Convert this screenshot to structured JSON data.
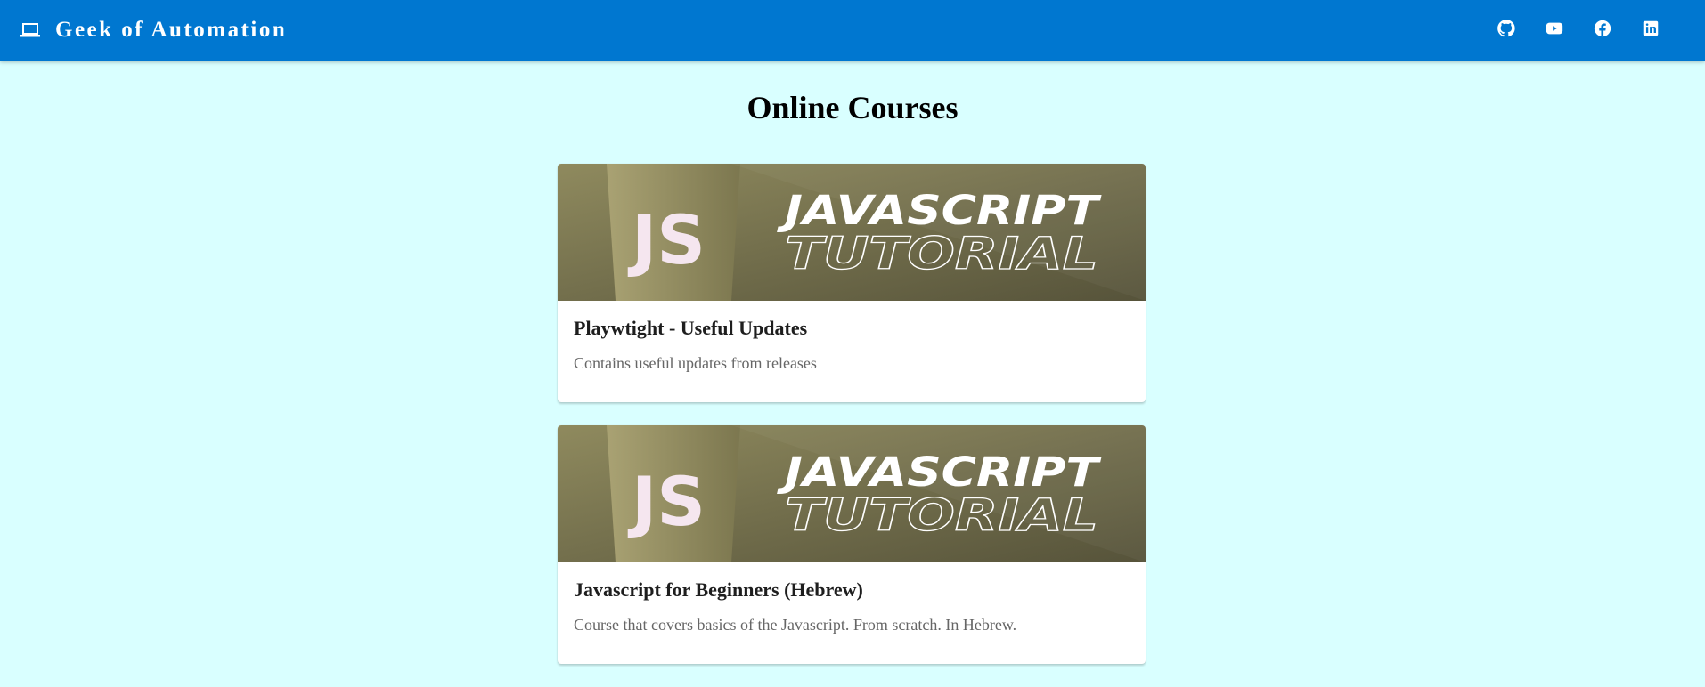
{
  "header": {
    "title": "Geek of Automation",
    "brand_icon": "laptop-icon",
    "social_icons": [
      "github-icon",
      "youtube-icon",
      "facebook-icon",
      "linkedin-icon"
    ],
    "background": "#0077d0"
  },
  "page": {
    "title": "Online Courses",
    "background": "#d9ffff"
  },
  "courses": [
    {
      "image": {
        "badge": "JS",
        "line1": "JAVASCRIPT",
        "line2": "TUTORIAL"
      },
      "title": "Playwtight - Useful Updates",
      "description": "Contains useful updates from releases"
    },
    {
      "image": {
        "badge": "JS",
        "line1": "JAVASCRIPT",
        "line2": "TUTORIAL"
      },
      "title": "Javascript for Beginners (Hebrew)",
      "description": "Course that covers basics of the Javascript. From scratch. In Hebrew."
    }
  ]
}
